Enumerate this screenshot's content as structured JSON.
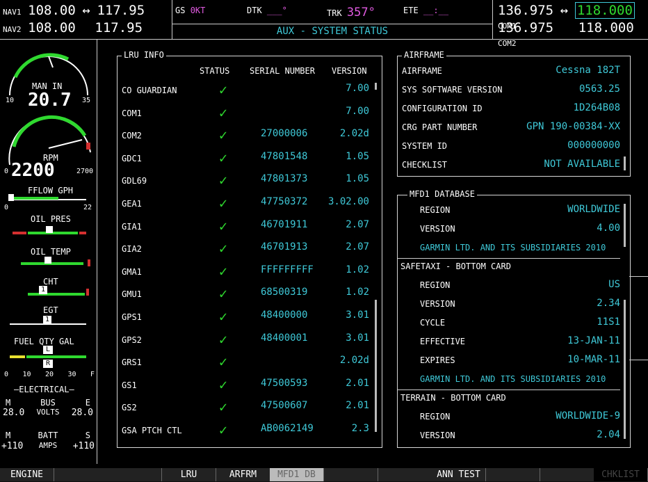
{
  "topbar": {
    "nav1_label": "NAV1",
    "nav1_active": "108.00",
    "nav1_swap": "↔",
    "nav1_standby": "117.95",
    "nav2_label": "NAV2",
    "nav2_active": "108.00",
    "nav2_standby": "117.95",
    "gs_label": "GS",
    "gs_value": "0KT",
    "dtk_label": "DTK",
    "dtk_value": "___°",
    "trk_label": "TRK",
    "trk_value": "357°",
    "ete_label": "ETE",
    "ete_value": "__:__",
    "page_title": "AUX - SYSTEM STATUS",
    "com1_standby": "136.975",
    "com1_swap": "↔",
    "com1_active": "118.000",
    "com1_label": "COM1",
    "com2_standby": "136.975",
    "com2_active": "118.000",
    "com2_label": "COM2"
  },
  "engine": {
    "man_in_label": "MAN IN",
    "man_in_value": "20.7",
    "man_min": "10",
    "man_max": "35",
    "rpm_label": "RPM",
    "rpm_value": "2200",
    "rpm_min": "0",
    "rpm_max": "2700",
    "fflow_label": "FFLOW GPH",
    "fflow_min": "0",
    "fflow_max": "22",
    "oil_pres_label": "OIL PRES",
    "oil_temp_label": "OIL TEMP",
    "cht_label": "CHT",
    "cht_marker": "1",
    "egt_label": "EGT",
    "egt_marker": "1",
    "fuel_label": "FUEL QTY GAL",
    "fuel_l": "L",
    "fuel_r": "R",
    "fuel_ticks": [
      "0",
      "10",
      "20",
      "30",
      "F"
    ],
    "electrical_label": "ELECTRICAL",
    "bus_m": "M",
    "bus_label": "BUS",
    "bus_e": "E",
    "volts_m": "28.0",
    "volts_label": "VOLTS",
    "volts_e": "28.0",
    "batt_m": "M",
    "batt_label": "BATT",
    "batt_s": "S",
    "amps_m": "+110",
    "amps_label": "AMPS",
    "amps_s": "+110"
  },
  "lru": {
    "title": "LRU INFO",
    "col_status": "STATUS",
    "col_serial": "SERIAL NUMBER",
    "col_version": "VERSION",
    "rows": [
      {
        "name": "CO GUARDIAN",
        "serial": "",
        "version": "7.00"
      },
      {
        "name": "COM1",
        "serial": "",
        "version": "7.00"
      },
      {
        "name": "COM2",
        "serial": "27000006",
        "version": "2.02d"
      },
      {
        "name": "GDC1",
        "serial": "47801548",
        "version": "1.05"
      },
      {
        "name": "GDL69",
        "serial": "47801373",
        "version": "1.05"
      },
      {
        "name": "GEA1",
        "serial": "47750372",
        "version": "3.02.00"
      },
      {
        "name": "GIA1",
        "serial": "46701911",
        "version": "2.07"
      },
      {
        "name": "GIA2",
        "serial": "46701913",
        "version": "2.07"
      },
      {
        "name": "GMA1",
        "serial": "FFFFFFFFF",
        "version": "1.02"
      },
      {
        "name": "GMU1",
        "serial": "68500319",
        "version": "1.02"
      },
      {
        "name": "GPS1",
        "serial": "48400000",
        "version": "3.01"
      },
      {
        "name": "GPS2",
        "serial": "48400001",
        "version": "3.01"
      },
      {
        "name": "GRS1",
        "serial": "",
        "version": "2.02d"
      },
      {
        "name": "GS1",
        "serial": "47500593",
        "version": "2.01"
      },
      {
        "name": "GS2",
        "serial": "47500607",
        "version": "2.01"
      },
      {
        "name": "GSA PTCH CTL",
        "serial": "AB0062149",
        "version": "2.3"
      }
    ]
  },
  "airframe": {
    "title": "AIRFRAME",
    "rows": [
      {
        "label": "AIRFRAME",
        "value": "Cessna 182T"
      },
      {
        "label": "SYS SOFTWARE VERSION",
        "value": "0563.25"
      },
      {
        "label": "CONFIGURATION ID",
        "value": "1D264B08"
      },
      {
        "label": "CRG PART NUMBER",
        "value": "GPN 190-00384-XX"
      },
      {
        "label": "SYSTEM ID",
        "value": "000000000"
      },
      {
        "label": "CHECKLIST",
        "value": "NOT AVAILABLE"
      }
    ]
  },
  "mfd_db": {
    "title": "MFD1 DATABASE",
    "region_label": "REGION",
    "region_value": "WORLDWIDE",
    "version_label": "VERSION",
    "version_value": "4.00",
    "copyright1": "GARMIN LTD. AND ITS SUBSIDIARIES 2010",
    "safetaxi_title": "SAFETAXI - BOTTOM CARD",
    "st_region_label": "REGION",
    "st_region_value": "US",
    "st_version_label": "VERSION",
    "st_version_value": "2.34",
    "st_cycle_label": "CYCLE",
    "st_cycle_value": "11S1",
    "st_effective_label": "EFFECTIVE",
    "st_effective_value": "13-JAN-11",
    "st_expires_label": "EXPIRES",
    "st_expires_value": "10-MAR-11",
    "copyright2": "GARMIN LTD. AND ITS SUBSIDIARIES 2010",
    "terrain_title": "TERRAIN - BOTTOM CARD",
    "tr_region_label": "REGION",
    "tr_region_value": "WORLDWIDE-9",
    "tr_version_label": "VERSION",
    "tr_version_value": "2.04"
  },
  "softkeys": [
    "ENGINE",
    "",
    "",
    "LRU",
    "ARFRM",
    "MFD1 DB",
    "",
    "",
    "ANN TEST",
    "",
    "",
    "CHKLIST"
  ]
}
